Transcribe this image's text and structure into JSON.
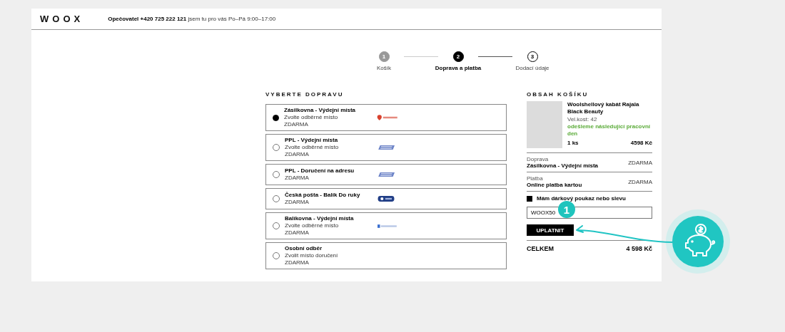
{
  "header": {
    "logo": "WOOX",
    "contact": "**Opečovatel +420 725 222 121** jsem tu pro vás Po–Pá 9:00–17:00"
  },
  "steps": [
    {
      "number": "1",
      "label": "Košík",
      "completed": true,
      "selected": false
    },
    {
      "number": "2",
      "label": "Doprava a platba",
      "completed": false,
      "selected": true
    },
    {
      "number": "3",
      "label": "Dodací údaje",
      "completed": false,
      "selected": false
    }
  ],
  "shipping": {
    "title": "VYBERTE DOPRAVU",
    "options": [
      {
        "name": "Zásilkovna - Výdejní místa",
        "note": "Zvolte odběrné místo",
        "price": "ZDARMA",
        "kind": "zasilkovna",
        "selected": true
      },
      {
        "name": "PPL - Výdejní místa",
        "note": "Zvolte odběrné místo",
        "price": "ZDARMA",
        "kind": "ppl",
        "selected": false
      },
      {
        "name": "PPL - Doručení na adresu",
        "price": "ZDARMA",
        "kind": "ppl",
        "selected": false
      },
      {
        "name": "Česká pošta - Balík Do ruky",
        "price": "ZDARMA",
        "kind": "posta",
        "selected": false
      },
      {
        "name": "Balíkovna - Výdejní místa",
        "note": "Zvolte odběrné místo",
        "price": "ZDARMA",
        "kind": "balikovna",
        "selected": false
      },
      {
        "name": "Osobní odběr",
        "note": "Zvolit místo doručení",
        "price": "ZDARMA",
        "kind": "personal",
        "selected": false
      }
    ]
  },
  "cart": {
    "title": "OBSAH KOŠÍKU",
    "item": {
      "name": "Woolshellový kabát Rajala Black Beauty",
      "size": "Vel.kost: 42",
      "shipping_note": "odešleme následující pracovní den",
      "quantity": "1 ks",
      "price": "4598 Kč"
    },
    "summary": [
      {
        "label": "Doprava",
        "value": "Zásilkovna - Výdejní místa",
        "price": "ZDARMA"
      },
      {
        "label": "Platba",
        "value": "Online platba kartou",
        "price": "ZDARMA"
      }
    ],
    "voucher": {
      "label": "Mám dárkový poukaz nebo slevu",
      "checked": true,
      "value": "WOOX50",
      "button": "UPLATNIT"
    },
    "total": {
      "label": "CELKEM",
      "value": "4 598 Kč"
    }
  },
  "callout": {
    "badge": "1"
  }
}
